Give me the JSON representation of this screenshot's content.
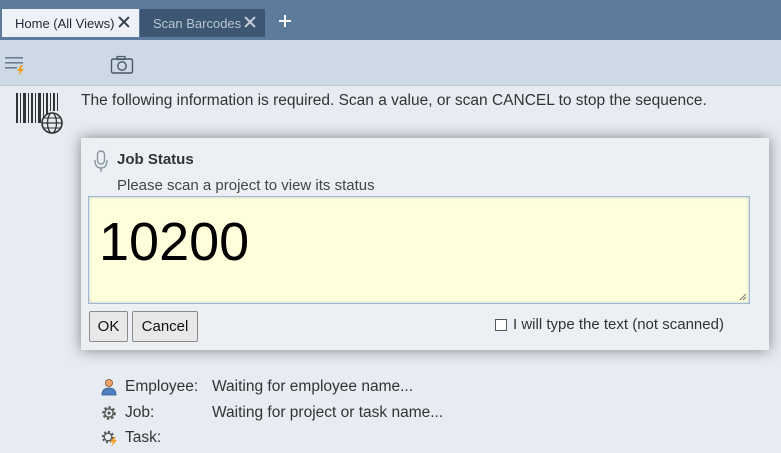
{
  "tabs": [
    {
      "label": "Home (All Views)",
      "active": true
    },
    {
      "label": "Scan Barcodes",
      "active": false
    }
  ],
  "toolbar": {
    "menu_icon": "menu-lines-bolt-icon",
    "camera_icon": "camera-icon"
  },
  "info": {
    "icon": "barcode-globe-icon",
    "text": "The following information is required. Scan a value, or scan CANCEL to stop the sequence."
  },
  "dialog": {
    "icon": "microphone-icon",
    "title": "Job Status",
    "subtitle": "Please scan a project to view its status",
    "scan_value": "10200",
    "ok_label": "OK",
    "cancel_label": "Cancel",
    "type_checkbox_label": "I will type the text (not scanned)",
    "type_checkbox_checked": false
  },
  "status": [
    {
      "icon": "person-icon",
      "label": "Employee:",
      "value": "Waiting for employee name..."
    },
    {
      "icon": "gear-icon",
      "label": "Job:",
      "value": "Waiting for project or task name..."
    },
    {
      "icon": "gear-bolt-icon",
      "label": "Task:",
      "value": ""
    }
  ],
  "colors": {
    "tabbar": "#5d7b9c",
    "toolbar": "#cdd9e5",
    "background": "#e6ecf2",
    "scan_box": "#ffffdc"
  }
}
